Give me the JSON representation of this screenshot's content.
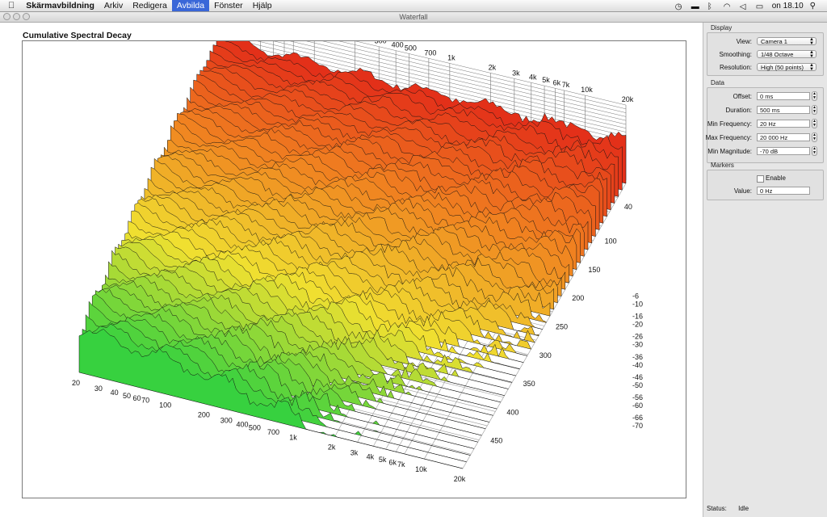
{
  "menubar": {
    "app": "Skärmavbildning",
    "items": [
      "Arkiv",
      "Redigera",
      "Avbilda",
      "Fönster",
      "Hjälp"
    ],
    "selected_index": 2,
    "clock": "on 18.10"
  },
  "window": {
    "title": "Waterfall"
  },
  "chart_data": {
    "type": "waterfall-3d",
    "title": "Cumulative Spectral Decay",
    "frequency_ticks": [
      "20",
      "30",
      "40",
      "50",
      "60",
      "70",
      "100",
      "200",
      "300",
      "400",
      "500",
      "700",
      "1k",
      "2k",
      "3k",
      "4k",
      "5k",
      "6k",
      "7k",
      "10k",
      "20k"
    ],
    "frequency_values": [
      20,
      30,
      40,
      50,
      60,
      70,
      100,
      200,
      300,
      400,
      500,
      700,
      1000,
      2000,
      3000,
      4000,
      5000,
      6000,
      7000,
      10000,
      20000
    ],
    "time_ticks": [
      "40",
      "100",
      "150",
      "200",
      "250",
      "300",
      "350",
      "400",
      "450"
    ],
    "time_values": [
      40,
      100,
      150,
      200,
      250,
      300,
      350,
      400,
      450
    ],
    "magnitude_ticks": [
      "-6",
      "-10",
      "-16",
      "-20",
      "-26",
      "-30",
      "-36",
      "-40",
      "-46",
      "-50",
      "-56",
      "-60",
      "-66",
      "-70"
    ],
    "magnitude_values": [
      -6,
      -10,
      -16,
      -20,
      -26,
      -30,
      -36,
      -40,
      -46,
      -50,
      -56,
      -60,
      -66,
      -70
    ],
    "frequency_range": [
      20,
      20000
    ],
    "time_range": [
      0,
      500
    ],
    "magnitude_range": [
      -70,
      0
    ],
    "grid": true,
    "colormap": [
      "#1030d0",
      "#20c8e8",
      "#30d040",
      "#f0e030",
      "#f08020",
      "#e02018"
    ]
  },
  "sidebar": {
    "display": {
      "label": "Display",
      "view_label": "View:",
      "view_value": "Camera 1",
      "smoothing_label": "Smoothing:",
      "smoothing_value": "1/48 Octave",
      "resolution_label": "Resolution:",
      "resolution_value": "High (50 points)"
    },
    "data": {
      "label": "Data",
      "offset_label": "Offset:",
      "offset_value": "0 ms",
      "duration_label": "Duration:",
      "duration_value": "500 ms",
      "minfreq_label": "Min Frequency:",
      "minfreq_value": "20 Hz",
      "maxfreq_label": "Max Frequency:",
      "maxfreq_value": "20 000 Hz",
      "minmag_label": "Min Magnitude:",
      "minmag_value": "-70 dB"
    },
    "markers": {
      "label": "Markers",
      "enable_label": "Enable",
      "value_label": "Value:",
      "value_value": "0 Hz"
    }
  },
  "status": {
    "label": "Status:",
    "value": "Idle"
  }
}
